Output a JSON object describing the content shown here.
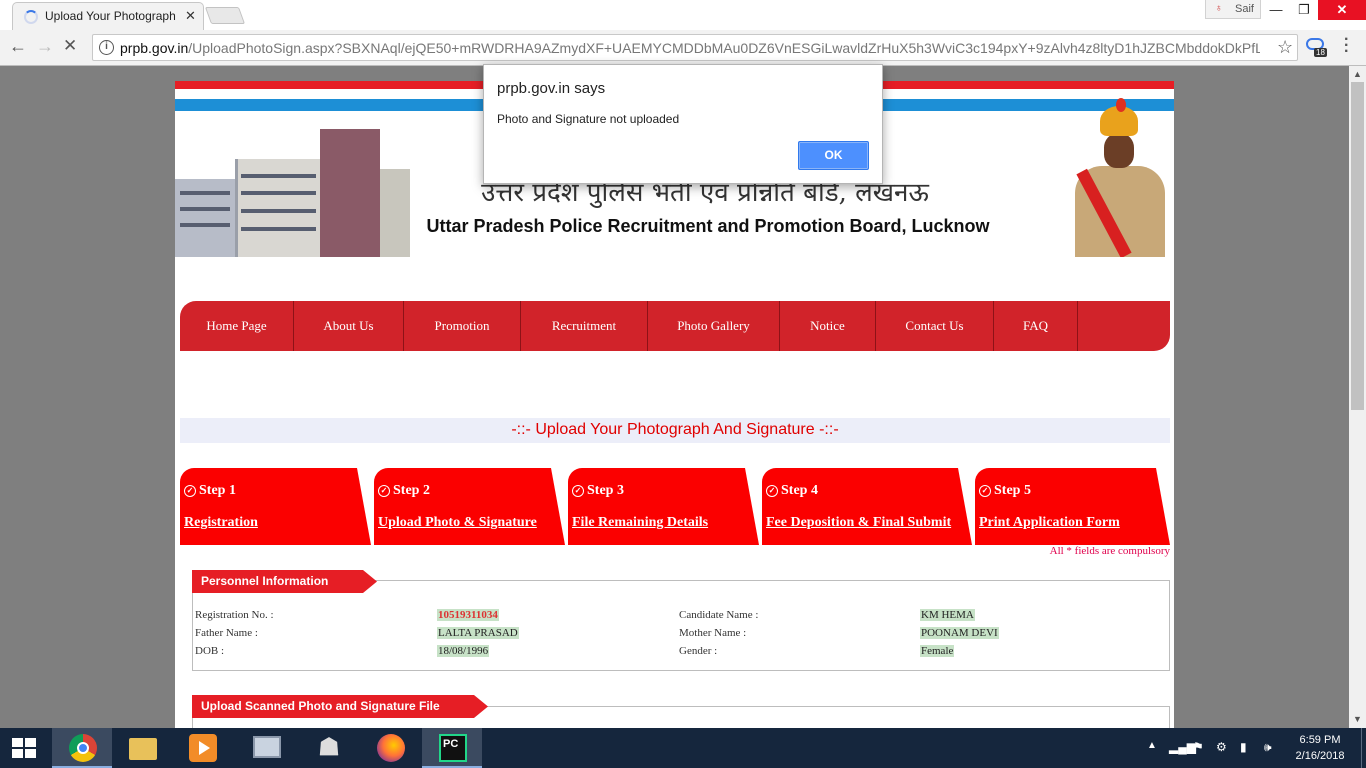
{
  "browser": {
    "tab_title": "Upload Your Photograph",
    "profile_name": "Saif",
    "url_host": "prpb.gov.in",
    "url_path": "/UploadPhotoSign.aspx?SBXNAql/ejQE50+mRWDRHA9AZmydXF+UAEMYCMDDbMAu0DZ6VnESGiLwavldZrHuX5h3WviC3c194pxY+9zAlvh4z8ltyD1hJZBCMbddokDkPfLvN2...",
    "extension_badge": "18"
  },
  "dialog": {
    "title": "prpb.gov.in says",
    "message": "Photo and Signature not uploaded",
    "ok_label": "OK"
  },
  "banner": {
    "hindi_title": "उत्तर प्रदेश पुलिस भर्ती एवं प्रोन्नति बोर्ड, लखनऊ",
    "english_title": "Uttar Pradesh Police Recruitment and Promotion Board, Lucknow"
  },
  "nav": {
    "items": [
      "Home Page",
      "About Us",
      "Promotion",
      "Recruitment",
      "Photo Gallery",
      "Notice",
      "Contact Us",
      "FAQ"
    ]
  },
  "page": {
    "heading": "-::- Upload Your Photograph And Signature -::-",
    "compulsory_note": "All * fields are compulsory"
  },
  "steps": [
    {
      "num": "Step 1",
      "label": "Registration"
    },
    {
      "num": "Step 2",
      "label": "Upload Photo & Signature"
    },
    {
      "num": "Step 3",
      "label": "File Remaining Details"
    },
    {
      "num": "Step 4",
      "label": "Fee Deposition & Final Submit"
    },
    {
      "num": "Step 5",
      "label": "Print Application Form"
    }
  ],
  "personal": {
    "section_title": "Personnel Information",
    "fields": {
      "reg_no_label": "Registration No. :",
      "reg_no": "10519311034",
      "cand_label": "Candidate Name :",
      "cand": "KM HEMA",
      "father_label": "Father Name :",
      "father": "LALTA PRASAD",
      "mother_label": "Mother Name :",
      "mother": "POONAM DEVI",
      "dob_label": "DOB :",
      "dob": "18/08/1996",
      "gender_label": "Gender :",
      "gender": "Female"
    }
  },
  "upload_section": {
    "title": "Upload Scanned Photo and Signature File"
  },
  "taskbar": {
    "time": "6:59 PM",
    "date": "2/16/2018"
  }
}
